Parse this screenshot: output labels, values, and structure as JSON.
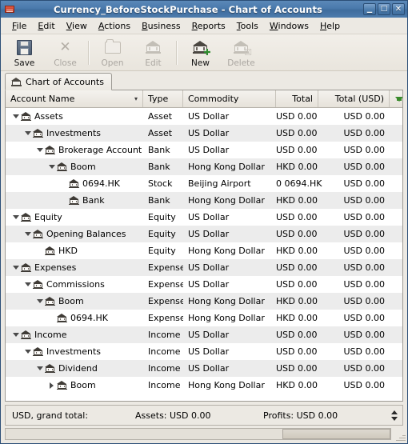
{
  "window": {
    "title": "Currency_BeforeStockPurchase - Chart of Accounts",
    "app_icon": "gnucash-icon",
    "minimize_label": "_",
    "maximize_label": "□",
    "close_label": "✕"
  },
  "menubar": {
    "items": [
      {
        "label": "File",
        "mnemonic": "F"
      },
      {
        "label": "Edit",
        "mnemonic": "E"
      },
      {
        "label": "View",
        "mnemonic": "V"
      },
      {
        "label": "Actions",
        "mnemonic": "A"
      },
      {
        "label": "Business",
        "mnemonic": "B"
      },
      {
        "label": "Reports",
        "mnemonic": "R"
      },
      {
        "label": "Tools",
        "mnemonic": "T"
      },
      {
        "label": "Windows",
        "mnemonic": "W"
      },
      {
        "label": "Help",
        "mnemonic": "H"
      }
    ]
  },
  "toolbar": {
    "buttons": [
      {
        "label": "Save",
        "icon": "floppy-disk-icon",
        "enabled": true
      },
      {
        "label": "Close",
        "icon": "close-x-icon",
        "enabled": false
      },
      {
        "label": "Open",
        "icon": "open-folder-icon",
        "enabled": false
      },
      {
        "label": "Edit",
        "icon": "edit-account-icon",
        "enabled": false
      },
      {
        "label": "New",
        "icon": "new-account-icon",
        "enabled": true
      },
      {
        "label": "Delete",
        "icon": "delete-account-icon",
        "enabled": false
      }
    ]
  },
  "tab": {
    "label": "Chart of Accounts",
    "icon": "bank-icon"
  },
  "table": {
    "columns": [
      {
        "key": "name",
        "label": "Account Name",
        "align": "left",
        "sorted": true
      },
      {
        "key": "type",
        "label": "Type",
        "align": "left"
      },
      {
        "key": "commodity",
        "label": "Commodity",
        "align": "left"
      },
      {
        "key": "total",
        "label": "Total",
        "align": "right"
      },
      {
        "key": "total_usd",
        "label": "Total (USD)",
        "align": "right"
      }
    ],
    "column_options_icon": "green-down-arrow-icon",
    "sort_indicator": "▾",
    "rows": [
      {
        "name": "Assets",
        "depth": 0,
        "expander": "down",
        "type": "Asset",
        "commodity": "US Dollar",
        "total": "USD 0.00",
        "total_usd": "USD 0.00"
      },
      {
        "name": "Investments",
        "depth": 1,
        "expander": "down",
        "type": "Asset",
        "commodity": "US Dollar",
        "total": "USD 0.00",
        "total_usd": "USD 0.00"
      },
      {
        "name": "Brokerage Account",
        "depth": 2,
        "expander": "down",
        "type": "Bank",
        "commodity": "US Dollar",
        "total": "USD 0.00",
        "total_usd": "USD 0.00"
      },
      {
        "name": "Boom",
        "depth": 3,
        "expander": "down",
        "type": "Bank",
        "commodity": "Hong Kong Dollar",
        "total": "HKD 0.00",
        "total_usd": "USD 0.00"
      },
      {
        "name": "0694.HK",
        "depth": 4,
        "expander": "none",
        "type": "Stock",
        "commodity": "Beijing Airport",
        "total": "0 0694.HK",
        "total_usd": "USD 0.00"
      },
      {
        "name": "Bank",
        "depth": 4,
        "expander": "none",
        "type": "Bank",
        "commodity": "Hong Kong Dollar",
        "total": "HKD 0.00",
        "total_usd": "USD 0.00"
      },
      {
        "name": "Equity",
        "depth": 0,
        "expander": "down",
        "type": "Equity",
        "commodity": "US Dollar",
        "total": "USD 0.00",
        "total_usd": "USD 0.00"
      },
      {
        "name": "Opening Balances",
        "depth": 1,
        "expander": "down",
        "type": "Equity",
        "commodity": "US Dollar",
        "total": "USD 0.00",
        "total_usd": "USD 0.00"
      },
      {
        "name": "HKD",
        "depth": 2,
        "expander": "none",
        "type": "Equity",
        "commodity": "Hong Kong Dollar",
        "total": "HKD 0.00",
        "total_usd": "USD 0.00"
      },
      {
        "name": "Expenses",
        "depth": 0,
        "expander": "down",
        "type": "Expense",
        "commodity": "US Dollar",
        "total": "USD 0.00",
        "total_usd": "USD 0.00"
      },
      {
        "name": "Commissions",
        "depth": 1,
        "expander": "down",
        "type": "Expense",
        "commodity": "US Dollar",
        "total": "USD 0.00",
        "total_usd": "USD 0.00"
      },
      {
        "name": "Boom",
        "depth": 2,
        "expander": "down",
        "type": "Expense",
        "commodity": "Hong Kong Dollar",
        "total": "HKD 0.00",
        "total_usd": "USD 0.00"
      },
      {
        "name": "0694.HK",
        "depth": 3,
        "expander": "none",
        "type": "Expense",
        "commodity": "Hong Kong Dollar",
        "total": "HKD 0.00",
        "total_usd": "USD 0.00"
      },
      {
        "name": "Income",
        "depth": 0,
        "expander": "down",
        "type": "Income",
        "commodity": "US Dollar",
        "total": "USD 0.00",
        "total_usd": "USD 0.00"
      },
      {
        "name": "Investments",
        "depth": 1,
        "expander": "down",
        "type": "Income",
        "commodity": "US Dollar",
        "total": "USD 0.00",
        "total_usd": "USD 0.00"
      },
      {
        "name": "Dividend",
        "depth": 2,
        "expander": "down",
        "type": "Income",
        "commodity": "US Dollar",
        "total": "USD 0.00",
        "total_usd": "USD 0.00"
      },
      {
        "name": "Boom",
        "depth": 3,
        "expander": "right",
        "type": "Income",
        "commodity": "Hong Kong Dollar",
        "total": "HKD 0.00",
        "total_usd": "USD 0.00"
      }
    ]
  },
  "summary": {
    "grand_total_label": "USD, grand total:",
    "assets": "Assets: USD 0.00",
    "profits": "Profits: USD 0.00",
    "spinner_icon": "up-down-spinner-icon"
  },
  "colors": {
    "titlebar": "#4a7aac",
    "row_even": "#ececec",
    "row_odd": "#ffffff",
    "chrome": "#ece9e3",
    "accent_green": "#3a8a2b"
  }
}
